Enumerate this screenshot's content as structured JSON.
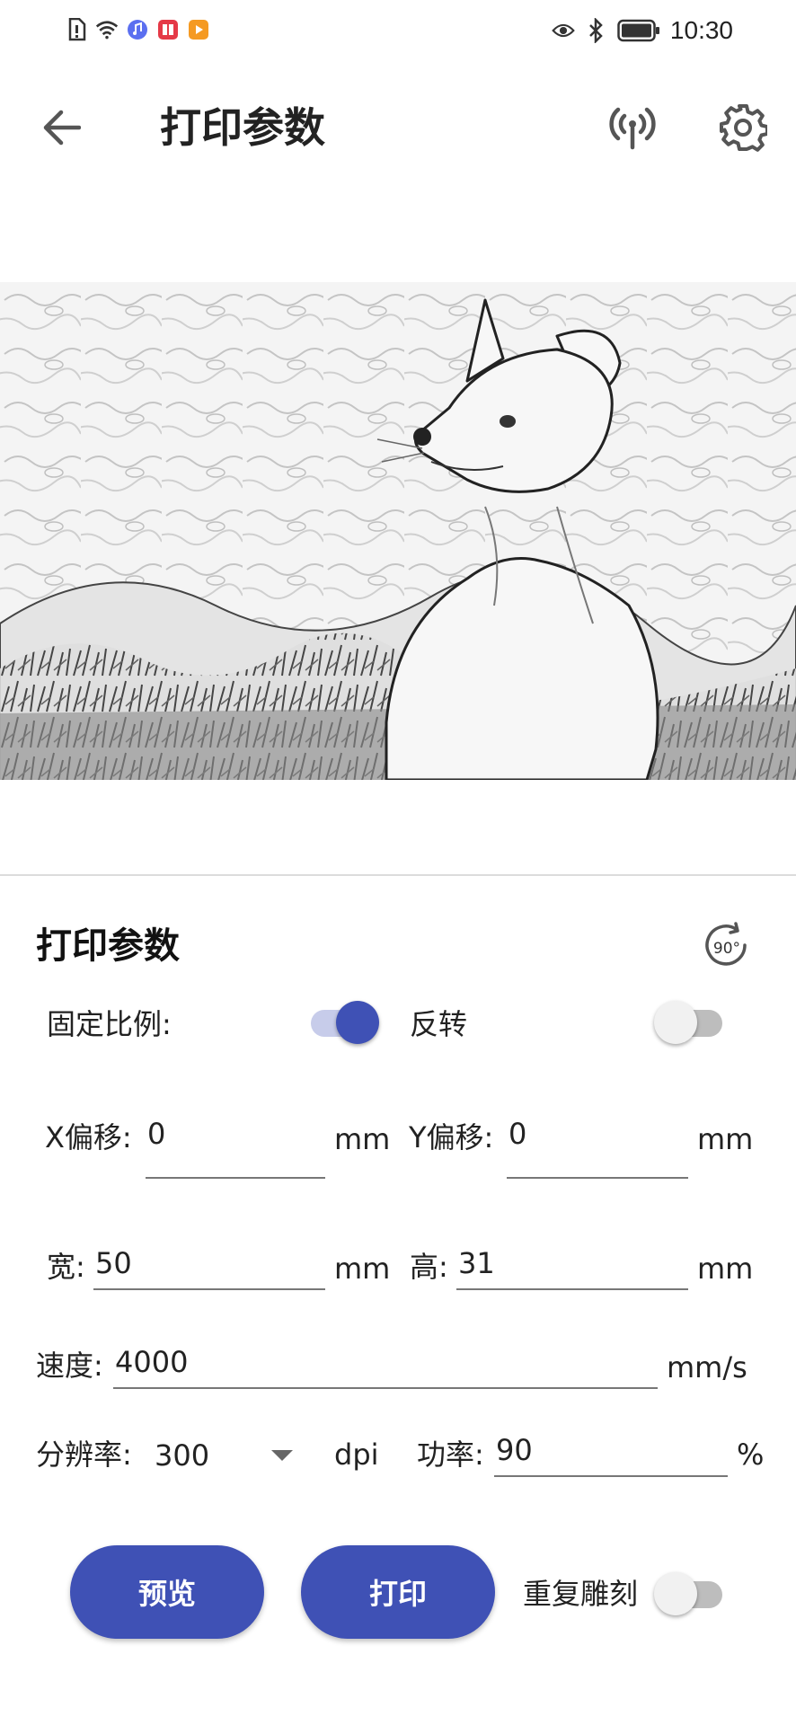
{
  "status_bar": {
    "time": "10:30"
  },
  "toolbar": {
    "title": "打印参数"
  },
  "panel": {
    "title": "打印参数",
    "rotate_label": "90°",
    "fixed_ratio_label": "固定比例:",
    "fixed_ratio_on": true,
    "invert_label": "反转",
    "invert_on": false,
    "x_offset_label": "X偏移:",
    "x_offset_value": "0",
    "x_offset_unit": "mm",
    "y_offset_label": "Y偏移:",
    "y_offset_value": "0",
    "y_offset_unit": "mm",
    "width_label": "宽:",
    "width_value": "50",
    "width_unit": "mm",
    "height_label": "高:",
    "height_value": "31",
    "height_unit": "mm",
    "speed_label": "速度:",
    "speed_value": "4000",
    "speed_unit": "mm/s",
    "resolution_label": "分辨率:",
    "resolution_value": "300",
    "resolution_unit": "dpi",
    "power_label": "功率:",
    "power_value": "90",
    "power_unit": "%"
  },
  "actions": {
    "preview_label": "预览",
    "print_label": "打印",
    "repeat_label": "重复雕刻",
    "repeat_on": false
  },
  "colors": {
    "accent": "#3f51b5",
    "accent_light": "#c7ccea"
  }
}
